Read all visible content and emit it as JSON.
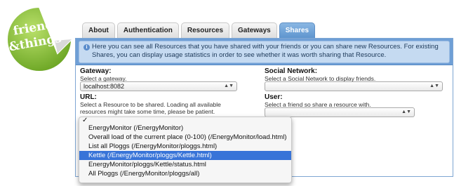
{
  "logo": {
    "line1": "friends",
    "line2": "&things"
  },
  "tabs": [
    {
      "label": "About"
    },
    {
      "label": "Authentication"
    },
    {
      "label": "Resources"
    },
    {
      "label": "Gateways"
    },
    {
      "label": "Shares",
      "active": true
    }
  ],
  "info": {
    "text": "Here you can see all Resources that you have shared with your friends or you can share new Resources. For existing Shares, you can display usage statistics in order to see whether it was worth sharing that Resource."
  },
  "gateway": {
    "label": "Gateway:",
    "hint": "Select a gateway.",
    "value": "localhost:8082"
  },
  "social": {
    "label": "Social Network:",
    "hint": "Select a Social Network to display friends.",
    "value": ""
  },
  "url": {
    "label": "URL:",
    "hint": "Select a Resource to be shared. Loading all available resources might take some time, please be patient."
  },
  "user": {
    "label": "User:",
    "hint": "Select a friend so share a resource with.",
    "value": ""
  },
  "dropdown": {
    "items": [
      "EnergyMonitor (/EnergyMonitor)",
      "Overall load of the current place (0-100) (/EnergyMonitor/load.html)",
      "List all Ploggs (/EnergyMonitor/ploggs.html)",
      "Kettle (/EnergyMonitor/ploggs/Kettle.html)",
      "EnergyMonitor/ploggs/Kettle/status.html",
      "All Ploggs (/EnergyMonitor/ploggs/all)"
    ],
    "highlighted_index": 3
  },
  "colors": {
    "accent": "#6f9fd6",
    "logo_green": "#8cc63f",
    "highlight": "#3874d8"
  }
}
